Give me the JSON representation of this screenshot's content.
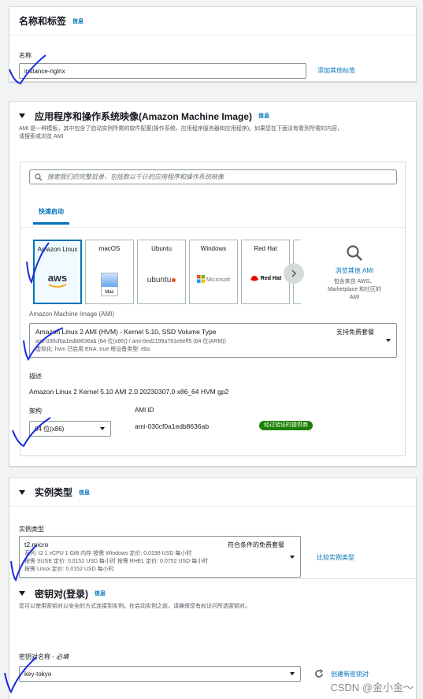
{
  "name_section": {
    "title": "名称和标签",
    "info": "信息",
    "name_label": "名称",
    "name_value": "instance-nginx",
    "add_tags": "添加其他标签"
  },
  "ami_section": {
    "title": "应用程序和操作系统映像(Amazon Machine Image)",
    "info": "信息",
    "desc_line1": "AMI 是一种模板，其中包含了启动实例所需的软件配置(操作系统、应用程序服务器和应用程序)。如果您在下面没有看到所需的内容，",
    "desc_line2": "请搜索或浏览 AMI",
    "search_placeholder": "搜索我们的完整目录，包括数以千计的应用程序和操作系统映像",
    "quick_start_tab": "快速启动",
    "os_tiles": [
      {
        "name": "Amazon Linux",
        "logo": "aws"
      },
      {
        "name": "macOS",
        "logo": "Mac"
      },
      {
        "name": "Ubuntu",
        "logo": "ubuntu"
      },
      {
        "name": "Windows",
        "logo": "Microsoft"
      },
      {
        "name": "Red Hat",
        "logo": "Red Hat"
      }
    ],
    "browse_more": "浏览其他 AMI",
    "browse_more_desc": "包含来自 AWS、Marketplace 和社区的 AMI",
    "ami_label": "Amazon Machine Image (AMI)",
    "ami_selected_name": "Amazon Linux 2 AMI (HVM) - Kernel 5.10, SSD Volume Type",
    "ami_free_tier": "支持免费套餐",
    "ami_ids": "ami-030cf0a1edb8636ab (64 位(x86)) / ami-0ed2199a781e8eff5 (64 位(ARM))",
    "ami_meta": "虚拟化: hvm    已启用 ENA: true    根设备类型: ebs",
    "description_label": "描述",
    "description_value": "Amazon Linux 2 Kernel 5.10 AMI 2.0.20230307.0 x86_64 HVM gp2",
    "arch_label": "架构",
    "arch_value": "64 位(x86)",
    "ami_id_label": "AMI ID",
    "ami_id_value": "ami-030cf0a1edb8636ab",
    "verified_badge": "经过验证的提供商"
  },
  "instance_section": {
    "title": "实例类型",
    "info": "信息",
    "type_label": "实例类型",
    "type_name": "t2.micro",
    "type_free": "符合条件的免费套餐",
    "line1": "系列: t2    1 vCPU    1 GiB 内存    按需 Windows 定价: 0.0198 USD 每小时",
    "line2": "按需 SUSE 定价: 0.0152 USD 每小时    按需 RHEL 定价: 0.0752 USD 每小时",
    "line3": "按需 Linux 定价: 0.0152 USD 每小时",
    "compare": "比较实例类型"
  },
  "keypair_section": {
    "title": "密钥对(登录)",
    "info": "信息",
    "desc": "您可以使用密钥对以安全的方式连接到实例。在启动实例之前，请确保您有权访问所选密钥对。",
    "label": "密钥对名称 - ",
    "label_required": "必填",
    "value": "key-tokyo",
    "create": "创建新密钥对"
  },
  "watermark": "CSDN @金小金～",
  "colors": {
    "link": "#0073bb",
    "badge": "#1d8102",
    "annotation": "#1a2adb"
  }
}
